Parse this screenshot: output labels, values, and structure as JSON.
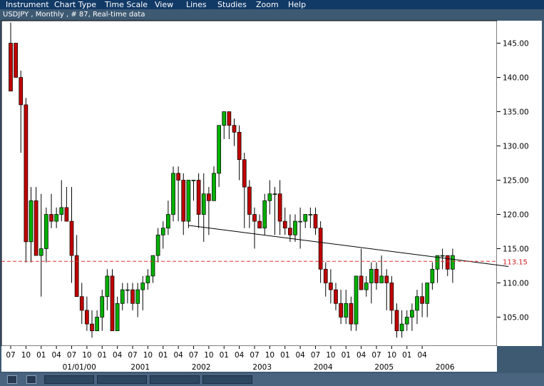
{
  "menu": {
    "items": [
      {
        "label": "Instrument"
      },
      {
        "label": "Chart Type"
      },
      {
        "label": "Time Scale"
      },
      {
        "label": "View"
      },
      {
        "label": "Lines"
      },
      {
        "label": "Studies"
      },
      {
        "label": "Zoom"
      },
      {
        "label": "Help"
      }
    ]
  },
  "chart_data": {
    "type": "candlestick",
    "title": "USDJPY , Monthly , # 87, Real-time data",
    "y_range": [
      101,
      149
    ],
    "y_ticks": [
      "145.00",
      "140.00",
      "135.00",
      "130.00",
      "125.00",
      "120.00",
      "115.00",
      "110.00",
      "105.00"
    ],
    "y_tick_values": [
      145,
      140,
      135,
      130,
      125,
      120,
      115,
      110,
      105
    ],
    "x_ticks": [
      "07",
      "10",
      "01",
      "04",
      "07",
      "10",
      "01",
      "04",
      "07",
      "10",
      "01",
      "04",
      "07",
      "10",
      "01",
      "04",
      "07",
      "10",
      "01",
      "04",
      "07",
      "10",
      "01",
      "04",
      "07",
      "10",
      "01",
      "04"
    ],
    "x_tick_months": [
      0,
      3,
      6,
      9,
      12,
      15,
      18,
      21,
      24,
      27,
      30,
      33,
      36,
      39,
      42,
      45,
      48,
      51,
      54,
      57,
      60,
      63,
      66,
      69,
      72,
      75,
      78,
      81
    ],
    "year_labels": [
      {
        "label": "01/01/00",
        "month": 13.5
      },
      {
        "label": "2001",
        "month": 25.5
      },
      {
        "label": "2002",
        "month": 37.5
      },
      {
        "label": "2003",
        "month": 49.5
      },
      {
        "label": "2004",
        "month": 61.5
      },
      {
        "label": "2005",
        "month": 73.5
      },
      {
        "label": "2006",
        "month": 85.5
      }
    ],
    "current_price": {
      "label": "113.15",
      "value": 113.15
    },
    "trendline": {
      "from": [
        35,
        118.4
      ],
      "to": [
        98,
        112.4
      ]
    },
    "colors": {
      "up": "#00b000",
      "down": "#c00000",
      "current_line": "#e03030",
      "current_label": "#d02020",
      "axis_text": "#000000",
      "background": "#ffffff",
      "frame": "#3e5a73"
    },
    "candles": [
      [
        145,
        148,
        138,
        138
      ],
      [
        145,
        145,
        140,
        140
      ],
      [
        140,
        141,
        129,
        136
      ],
      [
        136,
        137,
        113,
        116
      ],
      [
        116,
        124,
        113,
        122
      ],
      [
        122,
        124,
        114,
        114
      ],
      [
        114,
        123,
        108,
        115
      ],
      [
        115,
        121,
        113,
        120
      ],
      [
        120,
        123,
        118,
        119
      ],
      [
        119,
        121,
        118,
        120
      ],
      [
        120,
        125,
        119,
        121
      ],
      [
        121,
        124,
        119,
        119
      ],
      [
        119,
        124,
        110,
        114
      ],
      [
        114,
        117,
        111,
        108
      ],
      [
        108,
        110,
        104,
        106
      ],
      [
        106,
        108,
        103,
        104
      ],
      [
        104,
        106,
        102,
        103
      ],
      [
        103,
        106,
        103,
        105
      ],
      [
        105,
        109,
        103,
        108
      ],
      [
        108,
        112,
        106,
        111
      ],
      [
        111,
        112,
        103,
        103
      ],
      [
        103,
        108,
        103,
        107
      ],
      [
        107,
        110,
        106,
        109
      ],
      [
        109,
        110,
        107,
        109
      ],
      [
        109,
        110,
        106,
        107
      ],
      [
        107,
        110,
        105,
        109
      ],
      [
        109,
        111,
        106,
        110
      ],
      [
        110,
        112,
        109,
        111
      ],
      [
        111,
        114,
        110,
        114
      ],
      [
        114,
        118,
        113,
        117
      ],
      [
        117,
        119,
        115,
        118
      ],
      [
        118,
        122,
        117,
        120
      ],
      [
        120,
        127,
        119,
        126
      ],
      [
        126,
        127,
        119,
        125
      ],
      [
        125,
        126,
        117,
        119
      ],
      [
        119,
        125,
        118,
        125
      ],
      [
        125,
        125,
        122,
        125
      ],
      [
        125,
        126,
        118,
        120
      ],
      [
        120,
        126,
        116,
        123
      ],
      [
        123,
        124,
        117,
        122
      ],
      [
        122,
        127,
        122,
        126
      ],
      [
        126,
        133,
        124,
        133
      ],
      [
        133,
        135,
        131,
        135
      ],
      [
        135,
        135,
        131,
        133
      ],
      [
        133,
        134,
        130,
        132
      ],
      [
        132,
        133,
        125,
        128
      ],
      [
        128,
        129,
        118,
        124
      ],
      [
        124,
        125,
        118,
        120
      ],
      [
        120,
        121,
        115,
        119
      ],
      [
        119,
        120,
        118,
        118
      ],
      [
        118,
        123,
        117,
        122
      ],
      [
        122,
        125,
        120,
        123
      ],
      [
        123,
        124,
        117,
        123
      ],
      [
        123,
        125,
        117,
        119
      ],
      [
        119,
        121,
        117,
        118
      ],
      [
        118,
        120,
        116,
        117
      ],
      [
        117,
        120,
        116,
        119
      ],
      [
        119,
        121,
        115,
        119
      ],
      [
        119,
        120,
        118,
        120
      ],
      [
        120,
        121,
        118,
        120
      ],
      [
        120,
        121,
        117,
        118
      ],
      [
        118,
        119,
        110,
        112
      ],
      [
        112,
        113,
        108,
        110
      ],
      [
        110,
        112,
        107,
        109
      ],
      [
        109,
        110,
        106,
        107
      ],
      [
        107,
        109,
        104,
        105
      ],
      [
        105,
        109,
        104,
        107
      ],
      [
        107,
        108,
        103,
        104
      ],
      [
        104,
        111,
        103,
        111
      ],
      [
        111,
        115,
        109,
        109
      ],
      [
        109,
        111,
        108,
        110
      ],
      [
        110,
        113,
        107,
        112
      ],
      [
        112,
        113,
        109,
        110
      ],
      [
        110,
        114,
        110,
        111
      ],
      [
        111,
        112,
        106,
        110
      ],
      [
        110,
        111,
        104,
        106
      ],
      [
        106,
        107,
        102,
        103
      ],
      [
        103,
        106,
        102,
        104
      ],
      [
        104,
        106,
        103,
        105
      ],
      [
        105,
        107,
        103,
        106
      ],
      [
        106,
        109,
        104,
        108
      ],
      [
        108,
        110,
        105,
        107
      ],
      [
        107,
        110,
        105,
        110
      ],
      [
        110,
        113,
        109,
        112
      ],
      [
        112,
        114,
        110,
        114
      ],
      [
        114,
        115,
        112,
        114
      ],
      [
        114,
        114,
        111,
        112
      ],
      [
        112,
        115,
        110,
        114
      ]
    ]
  }
}
